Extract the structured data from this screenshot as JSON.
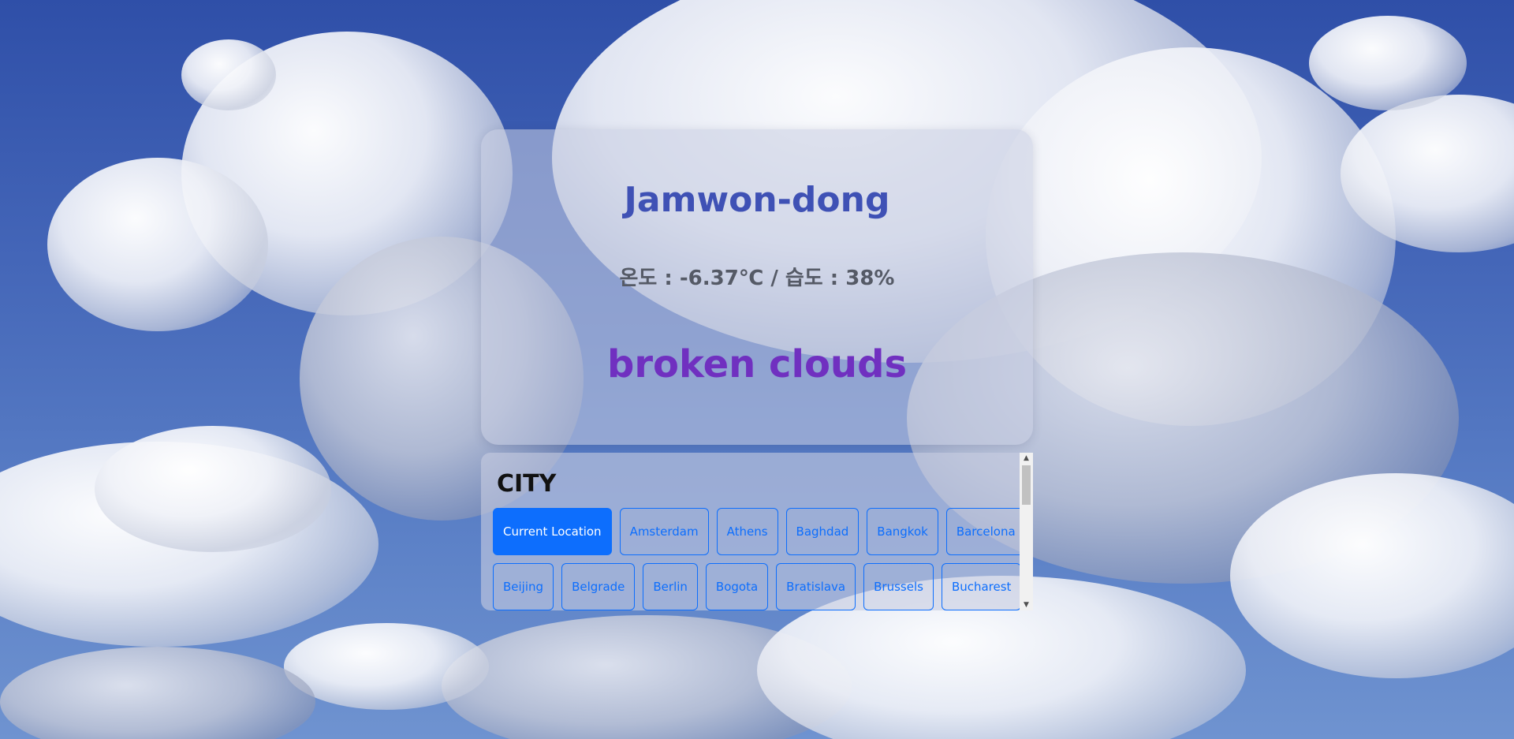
{
  "weather": {
    "location": "Jamwon-dong",
    "temp_humidity": "온도 : -6.37℃ / 습도 : 38%",
    "description": "broken clouds"
  },
  "city_panel": {
    "title": "CITY",
    "buttons_row1": [
      "Current Location",
      "Amsterdam",
      "Athens",
      "Baghdad",
      "Bangkok",
      "Barcelona"
    ],
    "buttons_row2": [
      "Beijing",
      "Belgrade",
      "Berlin",
      "Bogota",
      "Bratislava",
      "Brussels",
      "Bucharest"
    ],
    "active_button": "Current Location"
  },
  "colors": {
    "location": "#3f51b5",
    "description": "#7030c0",
    "button_primary": "#0d6efd"
  },
  "icons": {
    "scroll_up": "triangle-up-icon",
    "scroll_down": "triangle-down-icon"
  }
}
